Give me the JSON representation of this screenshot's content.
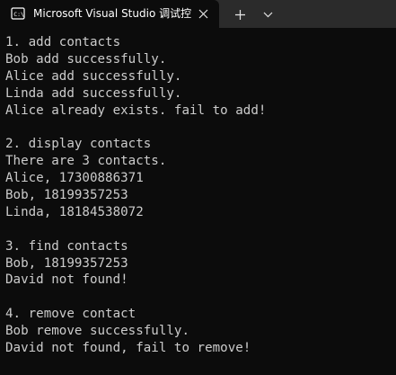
{
  "window": {
    "tab_title": "Microsoft Visual Studio 调试控",
    "icons": {
      "tab": "console-terminal-icon",
      "close": "close-icon",
      "new_tab": "plus-icon",
      "dropdown": "chevron-down-icon"
    }
  },
  "console": {
    "lines": [
      "1. add contacts",
      "Bob add successfully.",
      "Alice add successfully.",
      "Linda add successfully.",
      "Alice already exists. fail to add!",
      "",
      "2. display contacts",
      "There are 3 contacts.",
      "Alice, 17300886371",
      "Bob, 18199357253",
      "Linda, 18184538072",
      "",
      "3. find contacts",
      "Bob, 18199357253",
      "David not found!",
      "",
      "4. remove contact",
      "Bob remove successfully.",
      "David not found, fail to remove!"
    ]
  },
  "colors": {
    "background": "#0c0c0c",
    "titlebar": "#2b2b2b",
    "text": "#cccccc"
  }
}
